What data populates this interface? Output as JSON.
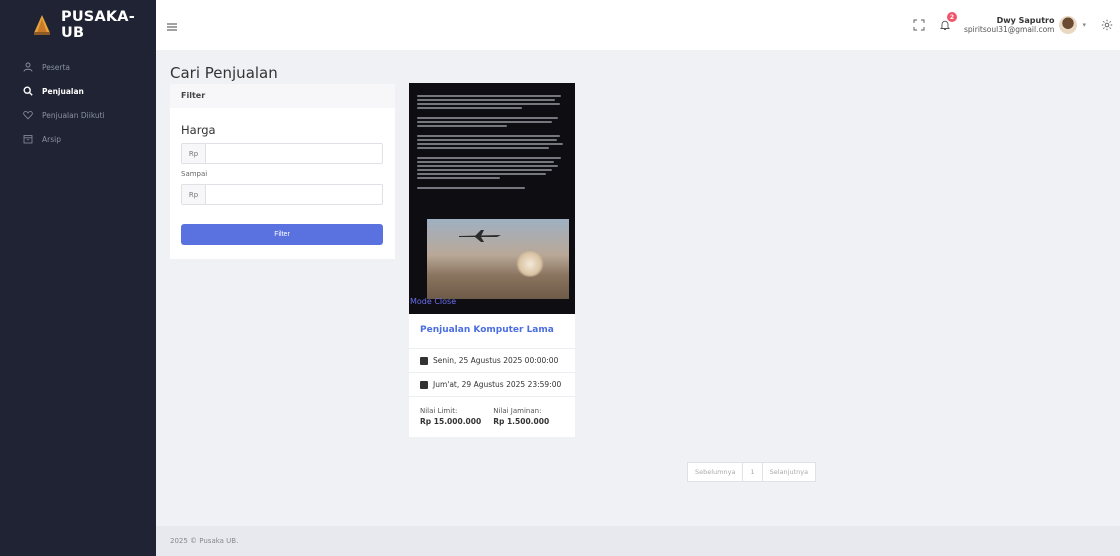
{
  "app": {
    "brand": "PUSAKA-UB"
  },
  "sidebar": {
    "items": [
      {
        "label": "Peserta",
        "icon": "user-icon",
        "active": false
      },
      {
        "label": "Penjualan",
        "icon": "search-icon",
        "active": true
      },
      {
        "label": "Penjualan Diikuti",
        "icon": "heart-icon",
        "active": false
      },
      {
        "label": "Arsip",
        "icon": "archive-icon",
        "active": false
      }
    ]
  },
  "topbar": {
    "notification_count": "2",
    "user_name": "Dwy Saputro",
    "user_email": "spiritsoul31@gmail.com"
  },
  "page": {
    "title": "Cari Penjualan"
  },
  "filter": {
    "header": "Filter",
    "harga_label": "Harga",
    "currency": "Rp",
    "sampai_label": "Sampai",
    "min_value": "",
    "max_value": "",
    "button_label": "Filter"
  },
  "auction": {
    "image_caption": "Mode Close",
    "title": "Penjualan Komputer Lama",
    "start_date": "Senin, 25 Agustus 2025 00:00:00",
    "end_date": "Jum'at, 29 Agustus 2025 23:59:00",
    "limit_label": "Nilai Limit:",
    "limit_value": "Rp 15.000.000",
    "jaminan_label": "Nilai Jaminan:",
    "jaminan_value": "Rp 1.500.000"
  },
  "pagination": {
    "prev": "Sebelumnya",
    "current": "1",
    "next": "Selanjutnya"
  },
  "footer": {
    "text": "2025 © Pusaka UB."
  },
  "colors": {
    "sidebar": "#1f2333",
    "accent": "#5a72e0",
    "link": "#4b6ee0",
    "badge": "#f1556c"
  }
}
